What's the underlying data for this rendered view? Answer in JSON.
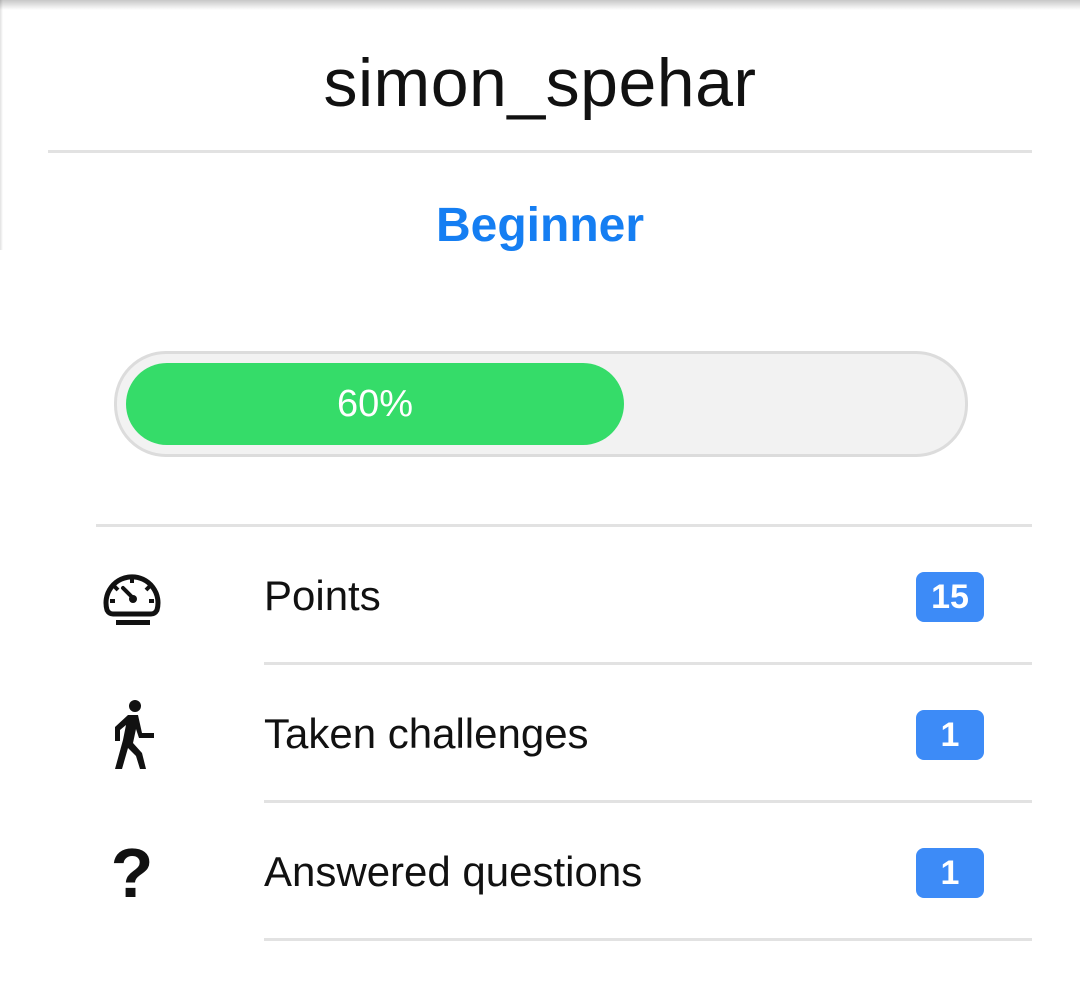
{
  "profile": {
    "username": "simon_spehar",
    "level": "Beginner",
    "progress_label": "60%",
    "progress_fraction": 0.6
  },
  "stats": [
    {
      "icon": "speedometer-icon",
      "label": "Points",
      "value": "15"
    },
    {
      "icon": "walking-person-icon",
      "label": "Taken challenges",
      "value": "1"
    },
    {
      "icon": "question-mark-icon",
      "label": "Answered questions",
      "value": "1"
    }
  ],
  "colors": {
    "level_text": "#157ef2",
    "progress_fill": "#35dc69",
    "badge": "#3d8bf7"
  }
}
